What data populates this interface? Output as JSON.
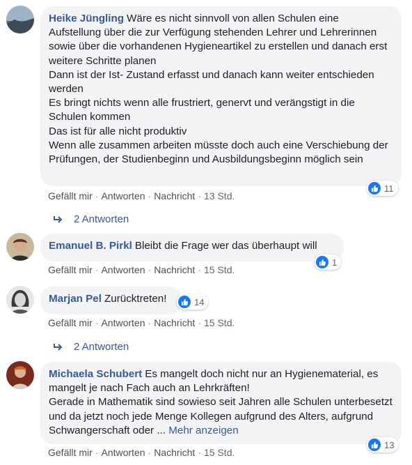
{
  "labels": {
    "like": "Gefällt mir",
    "reply": "Antworten",
    "message": "Nachricht",
    "separator": "·"
  },
  "comments": [
    {
      "author": "Heike Jüngling",
      "text": "Wäre es nicht sinnvoll von allen Schulen eine Aufstellung über die zur Verfügung stehenden Lehrer und Lehrerinnen sowie über die vorhandenen Hygieneartikel zu erstellen und danach erst weitere Schritte planen\nDann ist der Ist- Zustand erfasst und danach kann weiter entschieden werden\nEs bringt nichts wenn alle frustriert, genervt und verängstigt in die Schulen kommen\nDas ist für alle nicht produktiv\nWenn alle zusammen arbeiten müsste doch auch eine Verschiebung der Prüfungen, der Studienbeginn und Ausbildungsbeginn möglich sein",
      "reactions": "11",
      "time": "13 Std.",
      "replies": "2 Antworten"
    },
    {
      "author": "Emanuel B. Pirkl",
      "text": "Bleibt die Frage wer das überhaupt will",
      "reactions": "1",
      "time": "15 Std."
    },
    {
      "author": "Marjan Pel",
      "text": "Zurücktreten!",
      "reactions": "14",
      "time": "15 Std.",
      "replies": "2 Antworten"
    },
    {
      "author": "Michaela Schubert",
      "text": "Es mangelt doch nicht nur an Hygienematerial, es mangelt je nach Fach auch an Lehrkräften!\nGerade in Mathematik sind sowieso seit Jahren alle Schulen unterbesetzt und da jetzt noch jede Menge Kollegen aufgrund des Alters, aufgrund Schwangerschaft oder ... ",
      "more": "Mehr anzeigen",
      "reactions": "13",
      "time": "15 Std."
    }
  ],
  "colors": {
    "link": "#385898",
    "bubble": "#f2f3f5",
    "like_blue": "#1877f2",
    "meta": "#606770"
  }
}
